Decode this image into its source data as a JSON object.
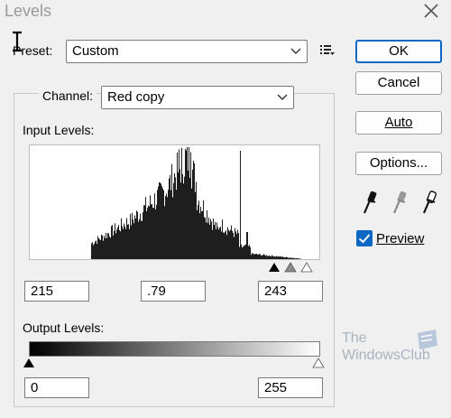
{
  "window": {
    "title": "Levels"
  },
  "preset": {
    "label": "Preset:",
    "value": "Custom"
  },
  "channel": {
    "label": "Channel:",
    "value": "Red copy"
  },
  "input_levels": {
    "label": "Input Levels:",
    "black": "215",
    "gamma": ".79",
    "white": "243"
  },
  "output_levels": {
    "label": "Output Levels:",
    "black": "0",
    "white": "255"
  },
  "buttons": {
    "ok": "OK",
    "cancel": "Cancel",
    "auto": "Auto",
    "options": "Options..."
  },
  "preview": {
    "label": "Preview",
    "checked": true
  },
  "watermark": {
    "line1": "The",
    "line2": "WindowsClub"
  },
  "colors": {
    "accent": "#0b67c4",
    "histogram": "#1e1e1e"
  },
  "icons": [
    "close-icon",
    "preset-menu-icon",
    "black-eyedropper-icon",
    "gray-eyedropper-icon",
    "white-eyedropper-icon",
    "checkmark-icon"
  ]
}
